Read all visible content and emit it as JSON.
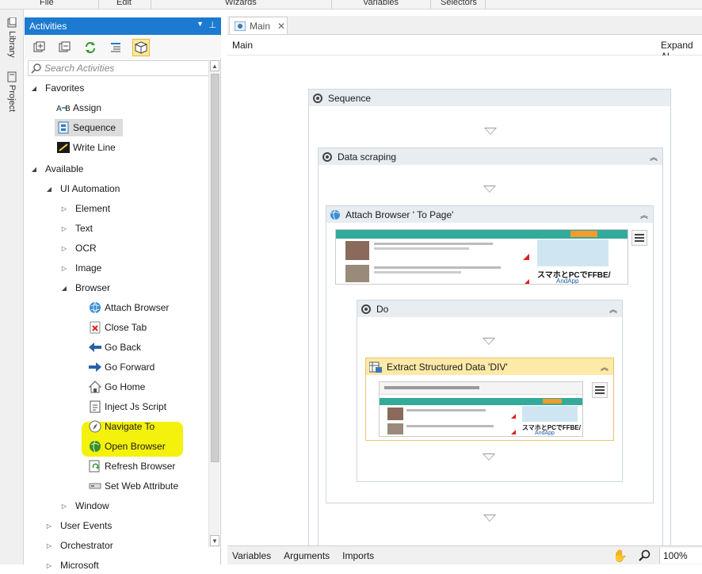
{
  "ribbon": {
    "groups": [
      "File",
      "Edit",
      "Wizards",
      "Variables",
      "Selectors"
    ]
  },
  "rail": {
    "tabs": [
      {
        "label": "Library",
        "icon": "library-icon"
      },
      {
        "label": "Project",
        "icon": "project-icon"
      }
    ]
  },
  "activities": {
    "title": "Activities",
    "search_placeholder": "Search Activities",
    "tree": [
      {
        "label": "Favorites",
        "expanded": true,
        "level": 0
      },
      {
        "label": "Assign",
        "icon": "assign-icon",
        "level": 1
      },
      {
        "label": "Sequence",
        "icon": "sequence-icon",
        "level": 1,
        "selected": true
      },
      {
        "label": "Write Line",
        "icon": "write-line-icon",
        "level": 1
      },
      {
        "label": "Available",
        "expanded": true,
        "level": 0
      },
      {
        "label": "UI Automation",
        "expanded": true,
        "level": 1
      },
      {
        "label": "Element",
        "level": 2
      },
      {
        "label": "Text",
        "level": 2
      },
      {
        "label": "OCR",
        "level": 2
      },
      {
        "label": "Image",
        "level": 2
      },
      {
        "label": "Browser",
        "expanded": true,
        "level": 2
      },
      {
        "label": "Attach Browser",
        "icon": "globe-icon",
        "level": 3
      },
      {
        "label": "Close Tab",
        "icon": "close-tab-icon",
        "level": 3
      },
      {
        "label": "Go Back",
        "icon": "arrow-left-icon",
        "level": 3
      },
      {
        "label": "Go Forward",
        "icon": "arrow-right-icon",
        "level": 3
      },
      {
        "label": "Go Home",
        "icon": "home-icon",
        "level": 3
      },
      {
        "label": "Inject Js Script",
        "icon": "script-icon",
        "level": 3
      },
      {
        "label": "Navigate To",
        "icon": "compass-icon",
        "level": 3
      },
      {
        "label": "Open Browser",
        "icon": "open-browser-icon",
        "level": 3,
        "highlighted": true
      },
      {
        "label": "Refresh Browser",
        "icon": "refresh-page-icon",
        "level": 3
      },
      {
        "label": "Set Web Attribute",
        "icon": "set-attribute-icon",
        "level": 3
      },
      {
        "label": "Window",
        "level": 2
      },
      {
        "label": "User Events",
        "level": 1
      },
      {
        "label": "Orchestrator",
        "level": 1
      },
      {
        "label": "Microsoft",
        "level": 1
      }
    ]
  },
  "designer": {
    "tab": "Main",
    "breadcrumb": "Main",
    "expand_all": "Expand Al",
    "sequence": "Sequence",
    "data_scraping": "Data scraping",
    "attach_browser": "Attach Browser '        To Page'",
    "do": "Do",
    "extract": "Extract Structured Data 'DIV'",
    "preview_banner": "スマホとPCでFFBE/",
    "preview_brand": "AndApp"
  },
  "statusbar": {
    "variables": "Variables",
    "arguments": "Arguments",
    "imports": "Imports",
    "zoom": "100%"
  },
  "colors": {
    "panel_header": "#1c7ad0",
    "highlight": "#f3f000",
    "extract_header": "#fde9a8"
  }
}
